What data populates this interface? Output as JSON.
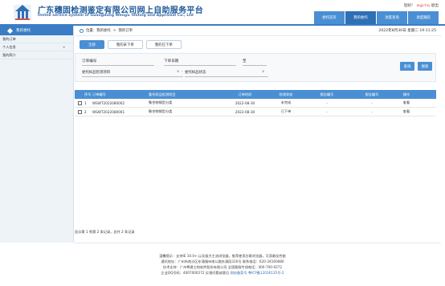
{
  "header": {
    "title_cn": "广东穗固检测鉴定有限公司网上自助服务平台",
    "title_en": "Online service system of Guangdong Wengu Testing and Appraisal Co., Ltd",
    "greeting": "您好！",
    "username": "wgjchq",
    "logout": "退出"
  },
  "nav": [
    "委托首页",
    "我的委托",
    "进度查询",
    "进度跟踪"
  ],
  "sidebar": {
    "heading": "我的委托",
    "items": [
      "我的订单",
      "个人信息",
      "我的简介"
    ]
  },
  "breadcrumb": {
    "location": "位置：",
    "item1": "我的委托",
    "sep": ">",
    "item2": "我的订单"
  },
  "datetime": "2022年8月30日 星期二 19:11:25",
  "tabs": [
    "全部",
    "我的未下单",
    "我的已下单"
  ],
  "filter": {
    "order_no_label": "订单编号",
    "date_label": "下单日期",
    "to_label": "至",
    "category_placeholder": "委托样品检测项目",
    "status_placeholder": "委托样品状态",
    "query_button": "查询",
    "reset_button": "搜索"
  },
  "table": {
    "headers": [
      "",
      "序号",
      "订单编号",
      "委托样品检测项目",
      "订单时间",
      "检测状态",
      "报告编号",
      "报告编号",
      "操作"
    ],
    "rows": [
      {
        "no": "1",
        "order": "WSWT2022080002",
        "item": "聚合物钢型分类",
        "date": "2022-08-30",
        "status": "未完成",
        "r1": "-",
        "r2": "-",
        "action": "查看"
      },
      {
        "no": "2",
        "order": "WSWT2022080001",
        "item": "聚合物钢型分类",
        "date": "2022-08-30",
        "status": "已下单",
        "r1": "-",
        "r2": "-",
        "action": "查看"
      }
    ]
  },
  "pager": "显示第 1 到第 2 条记录，总共 2 条记录",
  "footer": {
    "line1": "温馨提示：支持IE 10.0+,以及极大主流浏览器，推荐使用谷歌浏览器，可获最佳性能",
    "line2": "通讯地址：广州市南沙区东涌镇市南公路东涌段316号 联系电话：020-34160680",
    "line3": "技术支持：广州粤建三和软件股份有限公司 全国客服专线电话：400-700-0272",
    "line4_a": "企业QQ号码：4007000272 反馈问题或意见",
    "line4_b": "网站备案号 粤ICP备12036135号-2"
  },
  "colors": {
    "primary": "#4a8fd4",
    "dark_primary": "#2f6fb4",
    "title": "#1e5a9a"
  }
}
